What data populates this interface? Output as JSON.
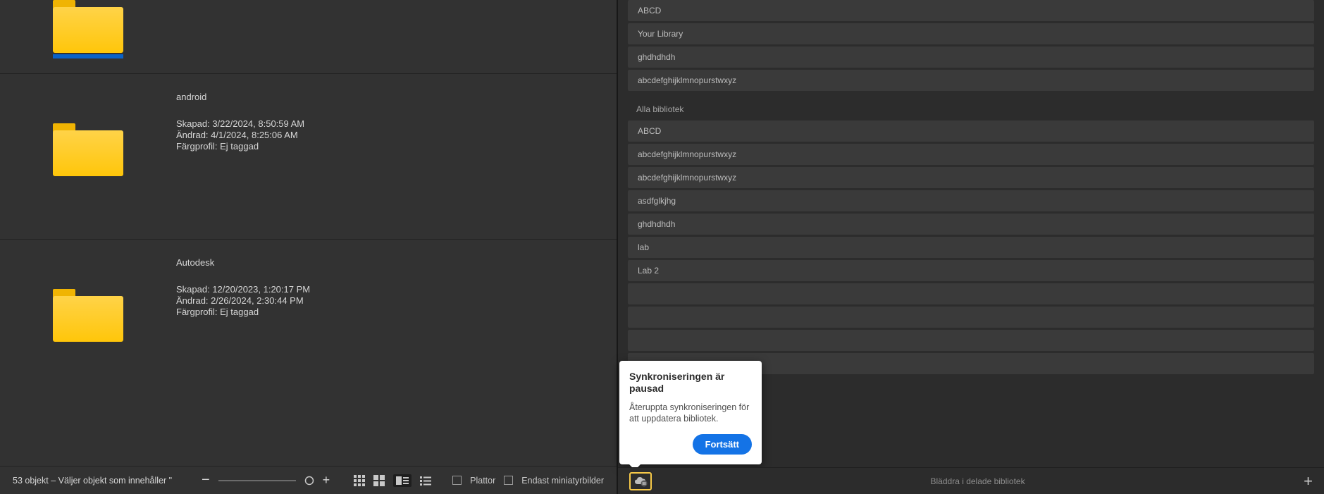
{
  "files": {
    "items": [
      {
        "name": "",
        "created": "",
        "modified": "",
        "profile": "",
        "selected": true
      },
      {
        "name": "android",
        "created": "Skapad: 3/22/2024, 8:50:59 AM",
        "modified": "Ändrad: 4/1/2024, 8:25:06 AM",
        "profile": "Färgprofil: Ej taggad",
        "selected": false
      },
      {
        "name": "Autodesk",
        "created": "Skapad: 12/20/2023, 1:20:17 PM",
        "modified": "Ändrad: 2/26/2024, 2:30:44 PM",
        "profile": "Färgprofil: Ej taggad",
        "selected": false
      }
    ]
  },
  "statusbar": {
    "text": "53 objekt – Väljer objekt som innehåller \"",
    "plattor_label": "Plattor",
    "thumbs_label": "Endast miniatyrbilder"
  },
  "libraries": {
    "recent": [
      {
        "label": "ABCD"
      },
      {
        "label": "Your Library"
      },
      {
        "label": "ghdhdhdh"
      },
      {
        "label": "abcdefghijklmnopurstwxyz"
      }
    ],
    "all_header": "Alla bibliotek",
    "all": [
      {
        "label": "ABCD"
      },
      {
        "label": "abcdefghijklmnopurstwxyz"
      },
      {
        "label": "abcdefghijklmnopurstwxyz"
      },
      {
        "label": "asdfglkjhg"
      },
      {
        "label": "ghdhdhdh"
      },
      {
        "label": "lab"
      },
      {
        "label": "Lab 2"
      },
      {
        "label": ""
      },
      {
        "label": ""
      },
      {
        "label": ""
      },
      {
        "label": ""
      }
    ]
  },
  "popover": {
    "title": "Synkroniseringen är pausad",
    "body": "Återuppta synkroniseringen för att uppdatera bibliotek.",
    "continue": "Fortsätt"
  },
  "right_footer": {
    "browse": "Bläddra i delade bibliotek"
  }
}
